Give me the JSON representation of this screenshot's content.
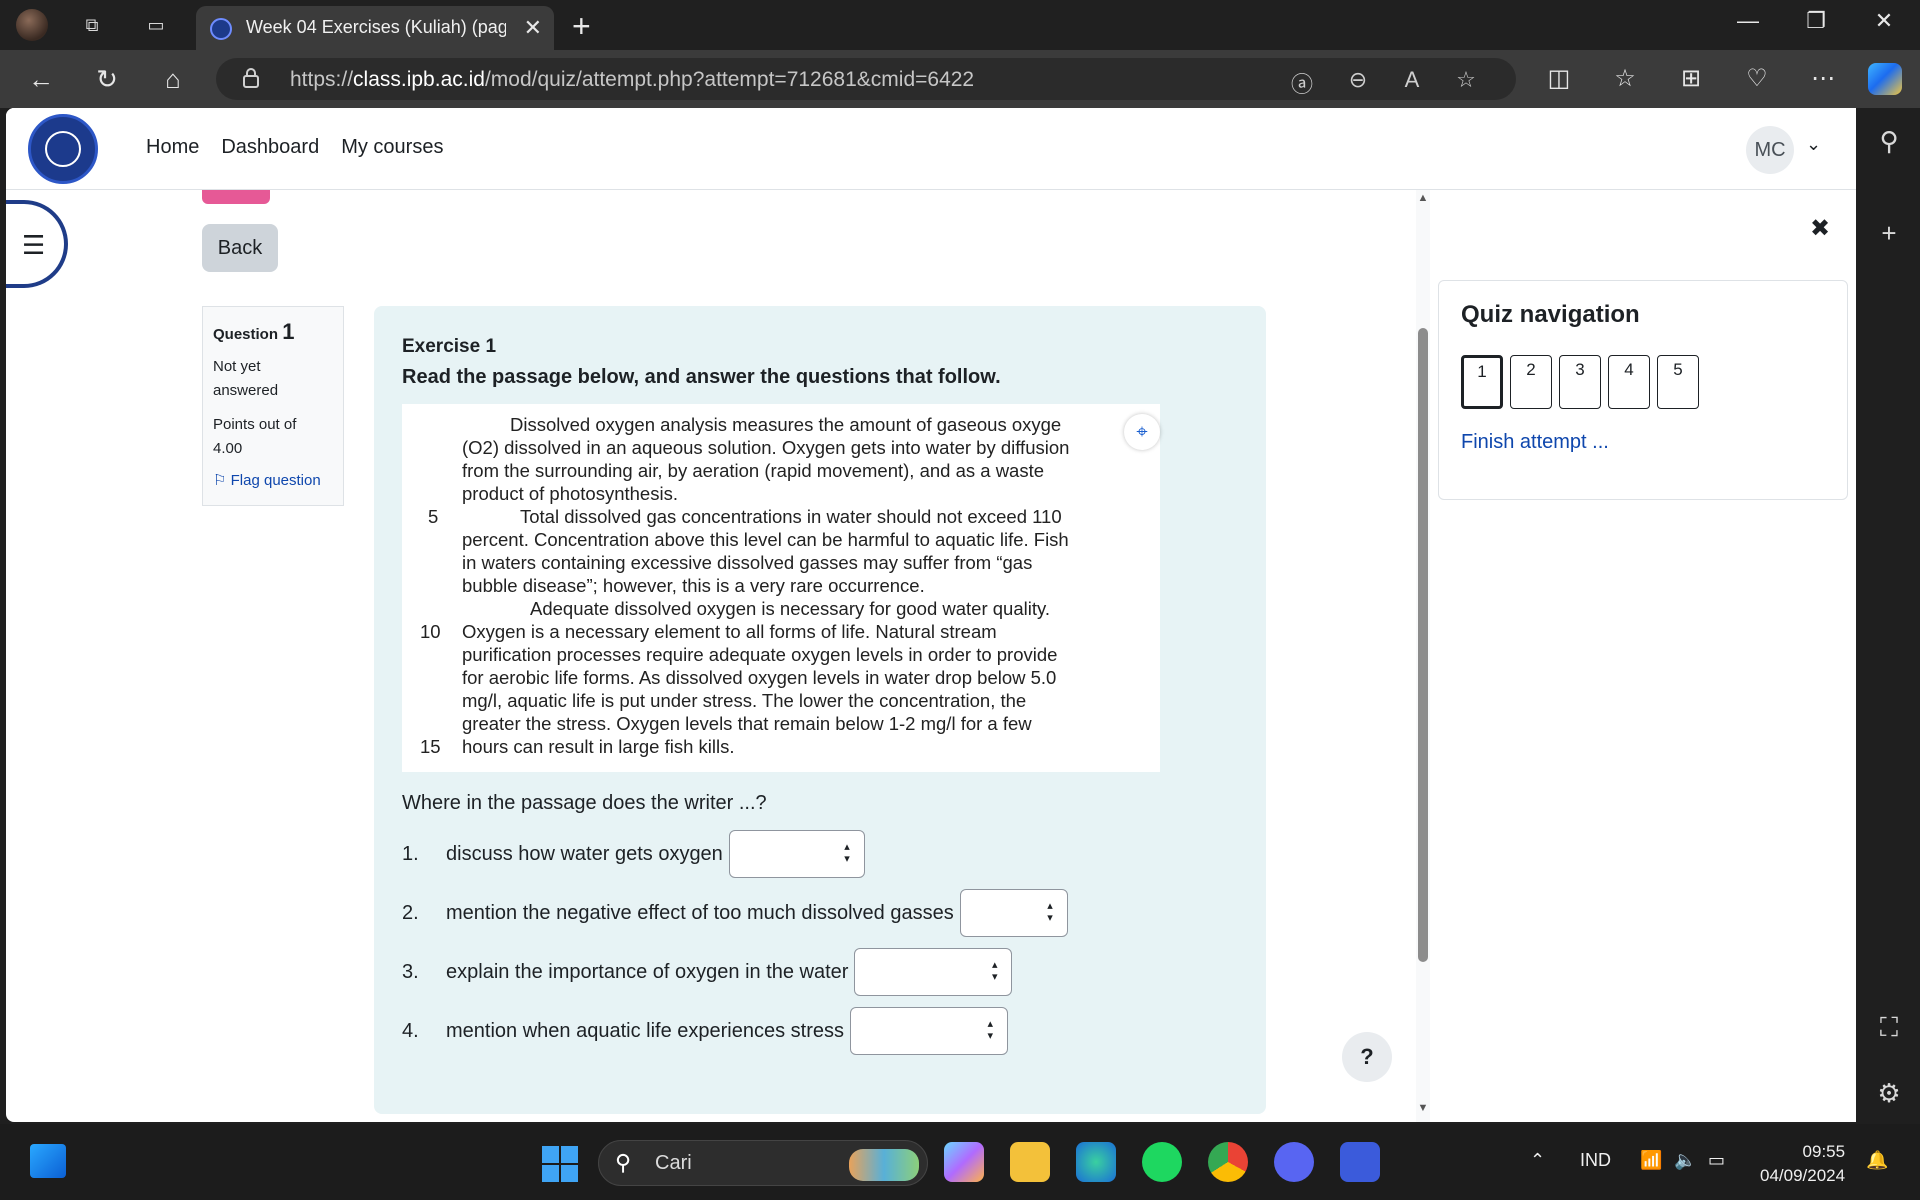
{
  "browser": {
    "tab_title": "Week 04 Exercises (Kuliah) (page",
    "tab_close": "✕",
    "new_tab": "+",
    "url_prefix": "https://",
    "url_host": "class.ipb.ac.id",
    "url_path": "/mod/quiz/attempt.php?attempt=712681&cmid=6422",
    "window_controls": [
      "—",
      "❐",
      "✕"
    ]
  },
  "header": {
    "nav": [
      "Home",
      "Dashboard",
      "My courses"
    ],
    "user_initials": "MC"
  },
  "page": {
    "back_label": "Back"
  },
  "question_info": {
    "label": "Question",
    "number": "1",
    "state_line1": "Not yet",
    "state_line2": "answered",
    "grade_line1": "Points out of",
    "grade_line2": "4.00",
    "flag_label": "Flag question"
  },
  "question": {
    "title": "Exercise 1",
    "instruction": "Read the passage below, and answer the questions that follow.",
    "passage_lines": [
      "Dissolved oxygen analysis measures the amount of gaseous oxyge",
      "(O2) dissolved in an aqueous solution. Oxygen gets into water by diffusion",
      "from the surrounding air, by aeration (rapid movement), and as a waste",
      "product of photosynthesis.",
      "Total dissolved gas concentrations in water should not exceed 110",
      "percent. Concentration above this level can be harmful to aquatic life. Fish",
      "in waters containing excessive dissolved gasses may suffer from “gas",
      "bubble disease”; however, this is a very rare occurrence.",
      "Adequate dissolved oxygen is necessary for good water quality.",
      "Oxygen is a necessary element to all forms of life. Natural stream",
      "purification processes require adequate oxygen levels in order to provide",
      "for aerobic life forms. As dissolved oxygen levels in water drop below 5.0",
      "mg/l, aquatic life is put under stress. The lower the concentration, the",
      "greater the stress. Oxygen levels that remain below 1-2 mg/l for a few",
      "hours can result in large fish kills."
    ],
    "line_numbers": [
      "5",
      "10",
      "15"
    ],
    "prompt": "Where in the passage does the writer ...?",
    "items": [
      {
        "num": "1.",
        "text": "discuss how water gets oxygen"
      },
      {
        "num": "2.",
        "text": "mention the negative effect of too much dissolved gasses"
      },
      {
        "num": "3.",
        "text": "explain the importance of oxygen in the water"
      },
      {
        "num": "4.",
        "text": "mention when aquatic life experiences stress"
      }
    ]
  },
  "quiz_nav": {
    "title": "Quiz navigation",
    "buttons": [
      "1",
      "2",
      "3",
      "4",
      "5"
    ],
    "finish_label": "Finish attempt ..."
  },
  "help_label": "?",
  "taskbar": {
    "search_placeholder": "Cari",
    "language": "IND",
    "time": "09:55",
    "date": "04/09/2024"
  }
}
